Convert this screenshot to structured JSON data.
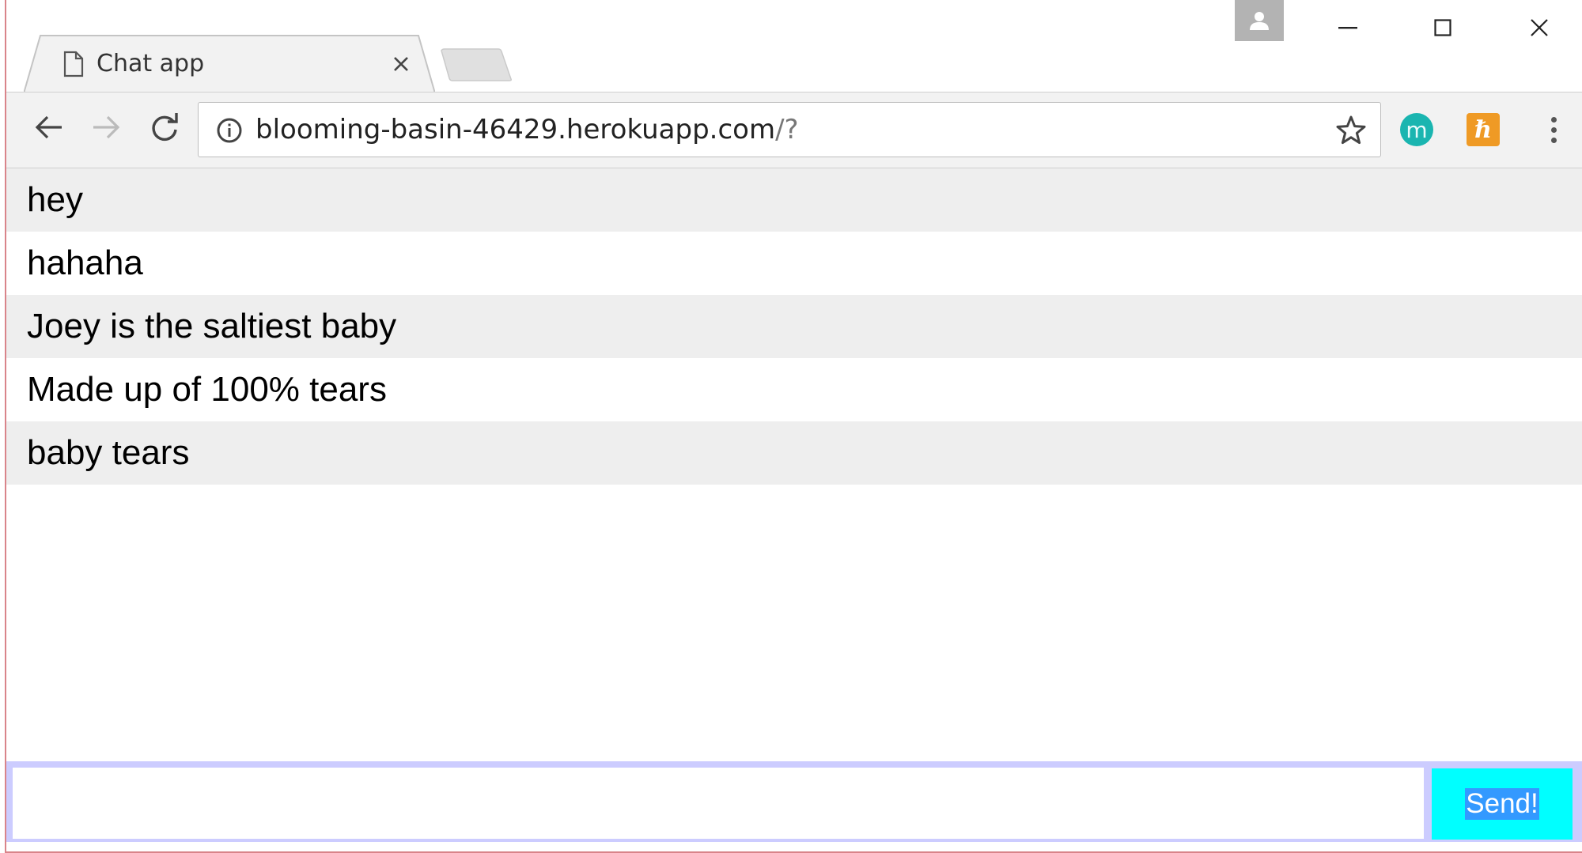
{
  "browser": {
    "tab": {
      "title": "Chat app",
      "icon": "page-icon",
      "close_icon": "close-icon"
    },
    "new_tab_icon": "new-tab-icon",
    "profile_icon": "person-icon",
    "window_controls": [
      "minimize-icon",
      "maximize-icon",
      "close-icon"
    ],
    "nav": {
      "back_icon": "arrow-left-icon",
      "forward_icon": "arrow-right-icon",
      "reload_icon": "reload-icon"
    },
    "address_bar": {
      "icon": "info-icon",
      "host": "blooming-basin-46429.herokuapp.com",
      "path": "/?",
      "bookmark_icon": "star-icon"
    },
    "extensions": [
      {
        "name": "m-extension-icon",
        "label": "m",
        "color": "#1ab5b0"
      },
      {
        "name": "h-extension-icon",
        "label": "ℏ",
        "color": "#ef9a25"
      }
    ],
    "menu_icon": "vertical-dots-icon"
  },
  "chat": {
    "messages": [
      "hey",
      "hahaha",
      "Joey is the saltiest baby",
      "Made up of 100% tears",
      "baby tears"
    ],
    "input_value": "",
    "send_label": "Send!"
  },
  "colors": {
    "message_odd_bg": "#eeeeee",
    "compose_bar_bg": "#ccccff",
    "send_button_bg": "#00ffff",
    "send_text_highlight": "#3399ff"
  }
}
